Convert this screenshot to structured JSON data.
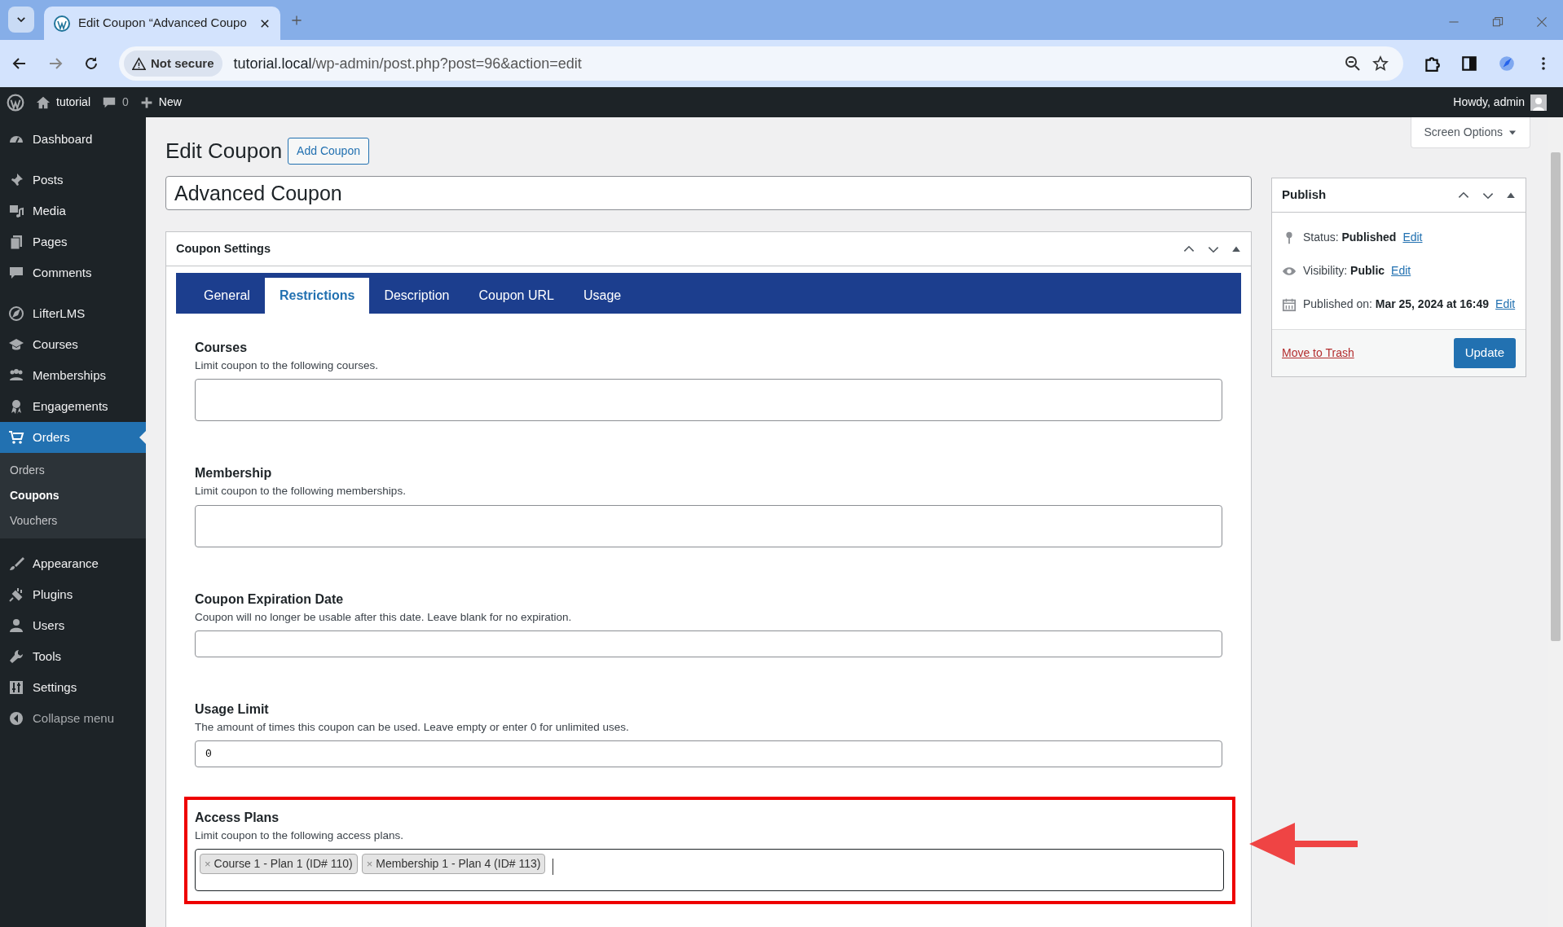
{
  "browser": {
    "tab_title": "Edit Coupon “Advanced Coupo",
    "security": "Not secure",
    "url_host": "tutorial.local",
    "url_path": "/wp-admin/post.php?post=96&action=edit"
  },
  "admin_bar": {
    "site": "tutorial",
    "comments": "0",
    "new": "New",
    "greeting": "Howdy, admin"
  },
  "sidebar": {
    "groups": [
      [
        {
          "label": "Dashboard",
          "selected": false
        }
      ],
      [
        {
          "label": "Posts",
          "selected": false
        },
        {
          "label": "Media",
          "selected": false
        },
        {
          "label": "Pages",
          "selected": false
        },
        {
          "label": "Comments",
          "selected": false
        }
      ],
      [
        {
          "label": "LifterLMS",
          "selected": false
        },
        {
          "label": "Courses",
          "selected": false
        },
        {
          "label": "Memberships",
          "selected": false
        },
        {
          "label": "Engagements",
          "selected": false
        },
        {
          "label": "Orders",
          "selected": true,
          "children": [
            {
              "label": "Orders",
              "selected": false
            },
            {
              "label": "Coupons",
              "selected": true
            },
            {
              "label": "Vouchers",
              "selected": false
            }
          ]
        }
      ],
      [
        {
          "label": "Appearance",
          "selected": false
        },
        {
          "label": "Plugins",
          "selected": false
        },
        {
          "label": "Users",
          "selected": false
        },
        {
          "label": "Tools",
          "selected": false
        },
        {
          "label": "Settings",
          "selected": false
        },
        {
          "label": "Collapse menu",
          "selected": false
        }
      ]
    ]
  },
  "screen_options": "Screen Options",
  "page": {
    "heading": "Edit Coupon",
    "add_button": "Add Coupon",
    "title_value": "Advanced Coupon"
  },
  "settings_box": {
    "title": "Coupon Settings",
    "tabs": [
      {
        "label": "General",
        "selected": false
      },
      {
        "label": "Restrictions",
        "selected": true
      },
      {
        "label": "Description",
        "selected": false
      },
      {
        "label": "Coupon URL",
        "selected": false
      },
      {
        "label": "Usage",
        "selected": false
      }
    ],
    "fields": [
      {
        "kind": "select",
        "label": "Courses",
        "help": "Limit coupon to the following courses.",
        "highlighted": false
      },
      {
        "kind": "select",
        "label": "Membership",
        "help": "Limit coupon to the following memberships.",
        "highlighted": false
      },
      {
        "kind": "text",
        "label": "Coupon Expiration Date",
        "help": "Coupon will no longer be usable after this date. Leave blank for no expiration.",
        "highlighted": false
      },
      {
        "kind": "text",
        "label": "Usage Limit",
        "help": "The amount of times this coupon can be used. Leave empty or enter 0 for unlimited uses.",
        "value": "0",
        "highlighted": false
      },
      {
        "kind": "tokens",
        "label": "Access Plans",
        "help": "Limit coupon to the following access plans.",
        "tokens": [
          {
            "remove": "×",
            "label": "Course 1 - Plan 1 (ID# 110)"
          },
          {
            "remove": "×",
            "label": "Membership 1 - Plan 4 (ID# 113)"
          }
        ],
        "highlighted": true
      }
    ]
  },
  "publish_box": {
    "title": "Publish",
    "rows": [
      {
        "label": "Status:",
        "value": "Published",
        "link": "Edit"
      },
      {
        "label": "Visibility:",
        "value": "Public",
        "link": "Edit"
      },
      {
        "label": "Published on:",
        "value": "Mar 25, 2024 at 16:49",
        "link": "Edit"
      }
    ],
    "trash": "Move to Trash",
    "update": "Update"
  }
}
